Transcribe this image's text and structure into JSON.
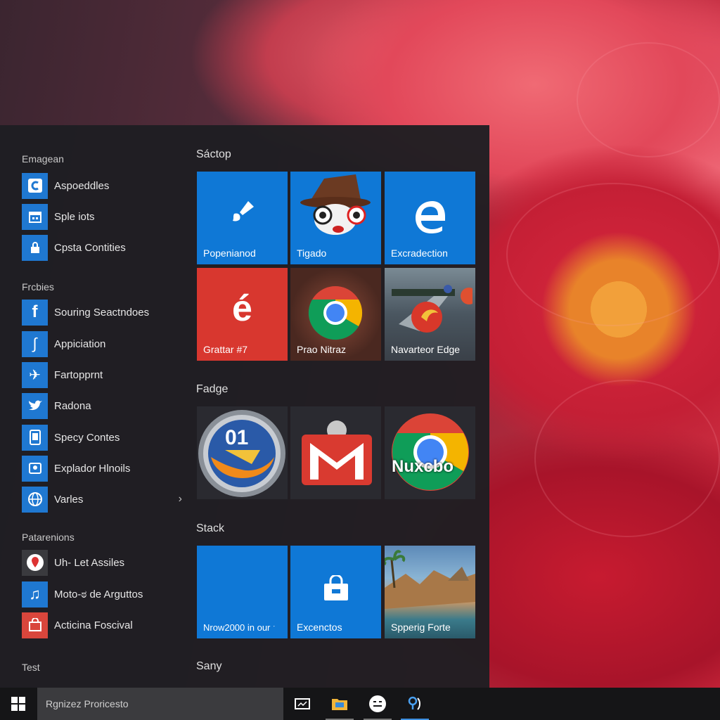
{
  "start_menu": {
    "groups": [
      {
        "label": "Emagean",
        "items": [
          {
            "label": "Aspoeddles",
            "icon": "c-icon"
          },
          {
            "label": "Sple iots",
            "icon": "calendar-icon"
          },
          {
            "label": "Cpsta Contities",
            "icon": "lock-icon"
          }
        ]
      },
      {
        "label": "Frcbies",
        "items": [
          {
            "label": "Souring Seactndoes",
            "icon": "facebook-icon"
          },
          {
            "label": "Appiciation",
            "icon": "swirl-icon"
          },
          {
            "label": "Fartopprnt",
            "icon": "plane-icon"
          },
          {
            "label": "Radona",
            "icon": "twitter-bird-icon"
          },
          {
            "label": "Specy Contes",
            "icon": "tablet-icon"
          },
          {
            "label": "Explador Hlnoils",
            "icon": "contacts-icon"
          },
          {
            "label": "Varles",
            "icon": "globe-icon"
          }
        ]
      },
      {
        "label": "Patarenions",
        "items": [
          {
            "label": "Uh- Let Assiles",
            "icon": "location-pin-icon"
          },
          {
            "label": "Moto-ಠ de Arguttos",
            "icon": "music-icon"
          },
          {
            "label": "Acticina Foscival",
            "icon": "store-icon"
          }
        ]
      },
      {
        "label": "Test",
        "items": []
      }
    ],
    "tile_groups": [
      {
        "label": "Sáctop",
        "tiles": [
          {
            "label": "Popenianod",
            "icon": "paintbrush-icon",
            "color": "#0f78d6"
          },
          {
            "label": "Tigado",
            "icon": "cartoon-face-icon",
            "color": "#0f78d6"
          },
          {
            "label": "Excradection",
            "icon": "edge-e-icon",
            "color": "#0f78d6"
          },
          {
            "label": "Grattar #7",
            "icon": "e-accent-icon",
            "color": "#d8372f"
          },
          {
            "label": "Prao Nitraz",
            "icon": "chrome-icon",
            "color": "#5a3a30"
          },
          {
            "label": "Navarteor Edge",
            "icon": "game-scene-icon",
            "color": "#4a5a6a"
          }
        ]
      },
      {
        "label": "Fadge",
        "tiles": [
          {
            "label": "",
            "icon": "firefox-icon",
            "badge": "01"
          },
          {
            "label": "",
            "icon": "gmail-icon"
          },
          {
            "label": "",
            "icon": "chrome-icon",
            "badge": "Nuxcbo"
          }
        ]
      },
      {
        "label": "Stack",
        "tiles": [
          {
            "label": "Nrow2000 in our ˑ",
            "icon": "",
            "color": "#0f78d6"
          },
          {
            "label": "Excenctos",
            "icon": "store-bag-icon",
            "color": "#0f78d6"
          },
          {
            "label": "Spperig Forte",
            "icon": "beach-photo-icon",
            "color": "#5d8aa8"
          }
        ]
      },
      {
        "label": "Sany",
        "tiles": []
      }
    ]
  },
  "taskbar": {
    "search_placeholder": "Rgnizez Proricesto",
    "icons": [
      {
        "name": "task-view-icon",
        "active": false
      },
      {
        "name": "file-explorer-icon",
        "active": false
      },
      {
        "name": "emoji-app-icon",
        "active": false
      },
      {
        "name": "maps-icon",
        "active": true
      }
    ]
  },
  "colors": {
    "accent_blue": "#0f78d6",
    "tile_red": "#d8372f",
    "panel_bg": "#1e1e22",
    "taskbar_bg": "#151517"
  }
}
